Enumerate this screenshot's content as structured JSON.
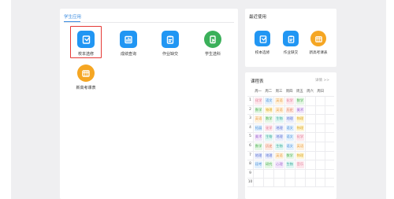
{
  "colors": {
    "accent": "#3a8be0",
    "selection": "#e53935",
    "tile_blue": "#2196f3",
    "tile_green": "#3bb05a",
    "tile_orange": "#f5a623"
  },
  "student_apps": {
    "title": "学生应用",
    "items": [
      {
        "label": "校本选修",
        "icon": "elective-course-icon",
        "color": "#2196f3",
        "selected": true
      },
      {
        "label": "成绩查询",
        "icon": "grade-query-icon",
        "color": "#2196f3"
      },
      {
        "label": "作业缺交",
        "icon": "homework-missing-icon",
        "color": "#2196f3"
      },
      {
        "label": "学生选科",
        "icon": "subject-select-icon",
        "color": "#3bb05a"
      },
      {
        "label": "新高考课表",
        "icon": "new-gaokao-timetable-icon",
        "color": "#f5a623"
      }
    ]
  },
  "recent": {
    "title": "最近使用",
    "items": [
      {
        "label": "校本选修",
        "icon": "elective-course-icon",
        "color": "#2196f3"
      },
      {
        "label": "作业缺交",
        "icon": "homework-missing-icon",
        "color": "#2196f3"
      },
      {
        "label": "新高考课表",
        "icon": "new-gaokao-timetable-icon",
        "color": "#f5a623"
      }
    ]
  },
  "timetable": {
    "title": "课程表",
    "more": "详情 >>",
    "days": [
      "周一",
      "周二",
      "周三",
      "周四",
      "周五",
      "周六",
      "周日"
    ],
    "rows": [
      {
        "period": "1",
        "cells": [
          "化学",
          "语文",
          "英语",
          "化学",
          "数学",
          "",
          ""
        ]
      },
      {
        "period": "2",
        "cells": [
          "数学",
          "物理",
          "英语",
          "历史",
          "美术",
          "",
          ""
        ]
      },
      {
        "period": "3",
        "cells": [
          "英语",
          "数学",
          "生物",
          "地理",
          "物理",
          "",
          ""
        ]
      },
      {
        "period": "4",
        "cells": [
          "拓展",
          "化学",
          "地理",
          "语文",
          "物理",
          "",
          ""
        ]
      },
      {
        "period": "5",
        "cells": [
          "美术",
          "生物",
          "地理",
          "语文",
          "化学",
          "",
          ""
        ]
      },
      {
        "period": "6",
        "cells": [
          "数学",
          "历史",
          "生物",
          "语文",
          "英语",
          "",
          ""
        ]
      },
      {
        "period": "7",
        "cells": [
          "地理",
          "地理",
          "英语",
          "数学",
          "物理",
          "",
          ""
        ]
      },
      {
        "period": "8",
        "cells": [
          "段考",
          "研究",
          "心理",
          "生物",
          "音乐",
          "",
          ""
        ]
      },
      {
        "period": "9",
        "cells": [
          "",
          "",
          "",
          "",
          "",
          "",
          ""
        ]
      },
      {
        "period": "10",
        "cells": [
          "",
          "",
          "",
          "",
          "",
          "",
          ""
        ]
      }
    ]
  }
}
